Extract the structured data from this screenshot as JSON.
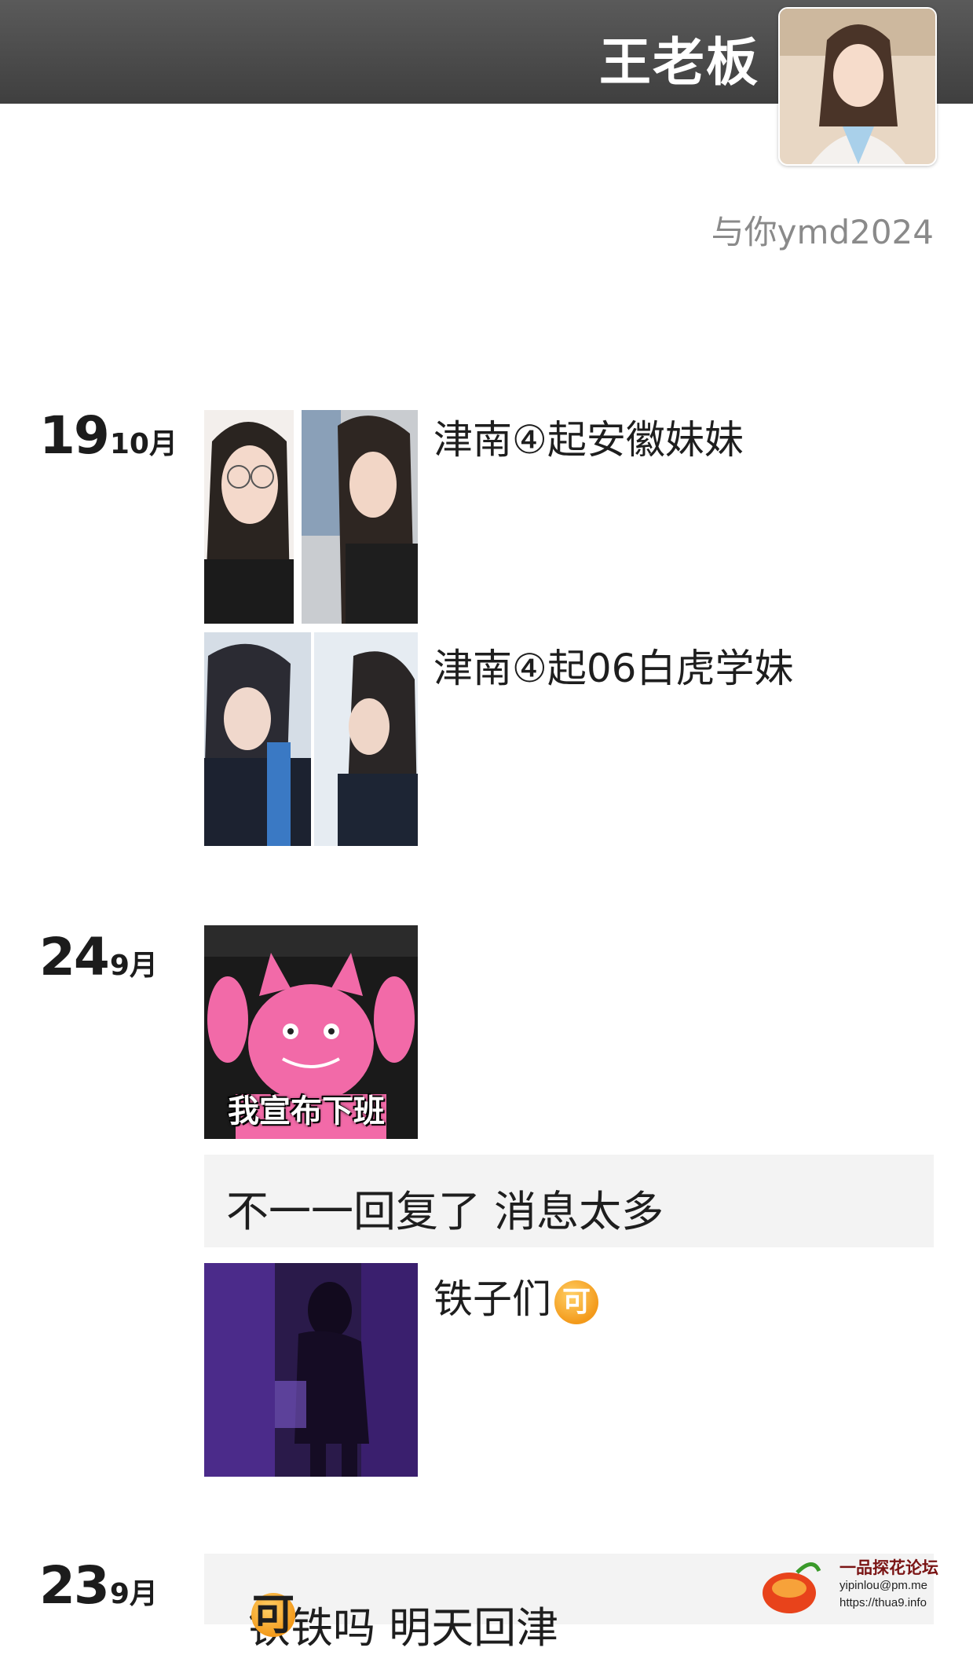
{
  "header": {
    "name": "王老板"
  },
  "profile": {
    "signature": "与你ymd2024"
  },
  "posts": [
    {
      "date": {
        "day": "19",
        "month": "10月"
      },
      "entries": [
        {
          "text": "津南④起安徽妹妹",
          "photos": 2
        },
        {
          "text": "津南④起06白虎学妹",
          "photos": 2
        }
      ]
    },
    {
      "date": {
        "day": "24",
        "month": "9月"
      },
      "entries": [
        {
          "caption": "我宣布下班",
          "photos": 1
        },
        {
          "text": "不一一回复了 消息太多"
        },
        {
          "text": "铁子们",
          "emoji": "可",
          "photos": 1
        }
      ]
    },
    {
      "date": {
        "day": "23",
        "month": "9月"
      },
      "entries": [
        {
          "text": "铁铁吗 明天回津",
          "emoji": "可"
        }
      ]
    }
  ],
  "watermark": {
    "title": "一品探花论坛",
    "email": "yipinlou@pm.me",
    "url": "https://thua9.info"
  },
  "colors": {
    "header_bg": "#4a4a4a",
    "card_bg": "#f3f3f3",
    "emoji": "#f39a1b"
  }
}
